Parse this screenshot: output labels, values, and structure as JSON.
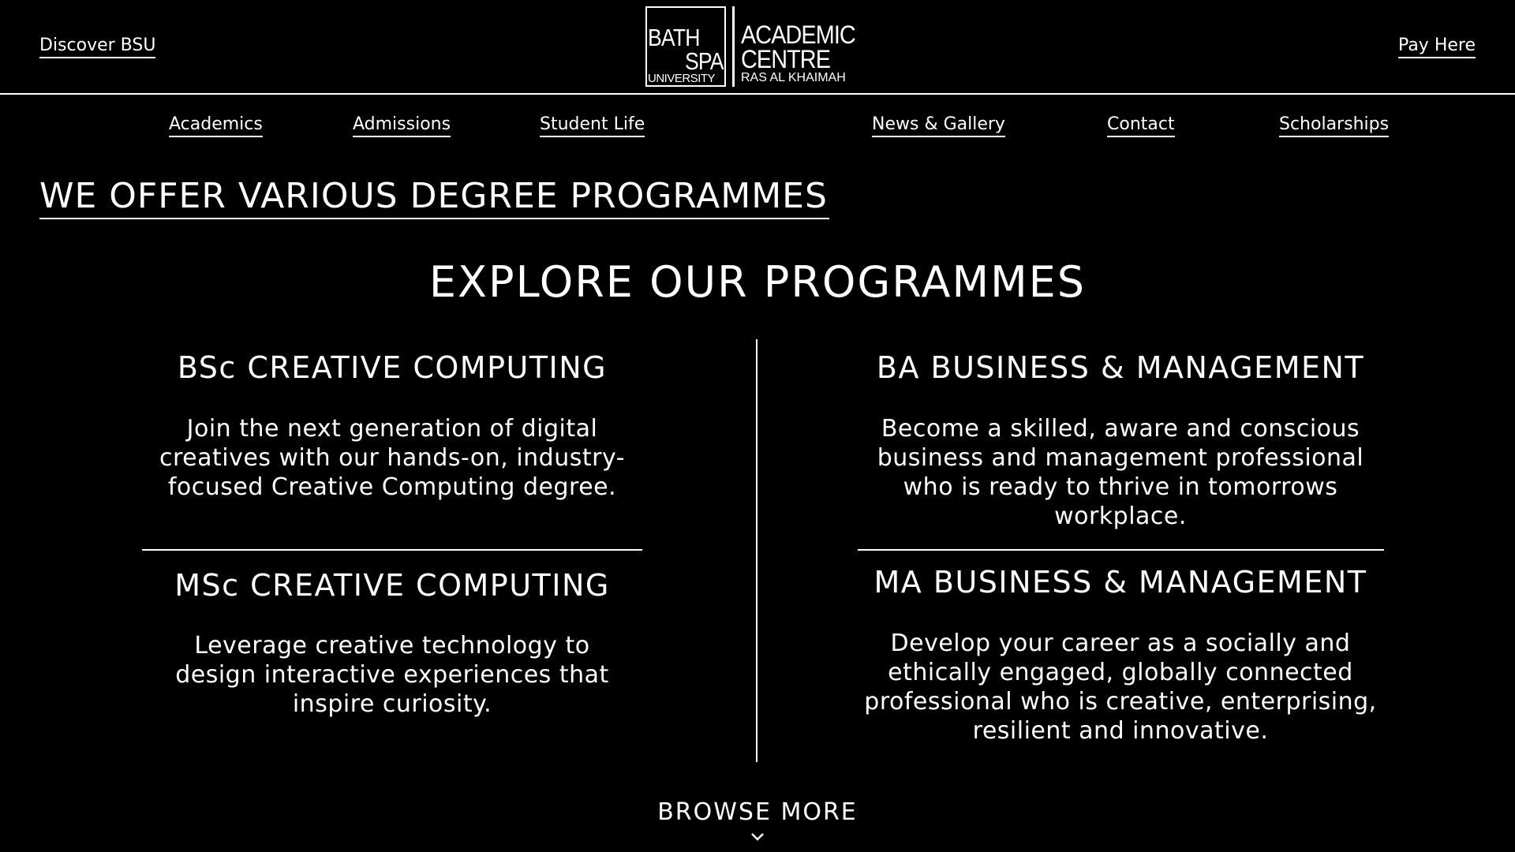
{
  "header": {
    "discover_label": "Discover BSU",
    "pay_label": "Pay Here",
    "logo": {
      "bath": "BATH",
      "spa": "SPA",
      "university": "UNIVERSITY",
      "academic": "ACADEMIC",
      "centre": "CENTRE",
      "location": "RAS AL KHAIMAH"
    }
  },
  "nav": {
    "items": [
      "Academics",
      "Admissions",
      "Student Life",
      "News & Gallery",
      "Contact",
      "Scholarships"
    ]
  },
  "main": {
    "headline": "WE OFFER VARIOUS DEGREE PROGRAMMES",
    "section_title": "EXPLORE OUR PROGRAMMES",
    "programmes": [
      {
        "title": "BSc CREATIVE COMPUTING",
        "description": "Join the next generation of digital creatives with our hands-on, industry-focused Creative Computing degree."
      },
      {
        "title": "MSc CREATIVE COMPUTING",
        "description": "Leverage creative technology to design interactive experiences that inspire curiosity."
      },
      {
        "title": "BA BUSINESS & MANAGEMENT",
        "description": "Become a skilled, aware and conscious business and management professional who is ready to thrive in tomorrows workplace."
      },
      {
        "title": "MA BUSINESS & MANAGEMENT",
        "description": "Develop your career as a socially and ethically engaged, globally connected professional who is creative, enterprising, resilient and innovative."
      }
    ],
    "browse_more": "BROWSE MORE"
  },
  "colors": {
    "background": "#000000",
    "foreground": "#ffffff"
  }
}
